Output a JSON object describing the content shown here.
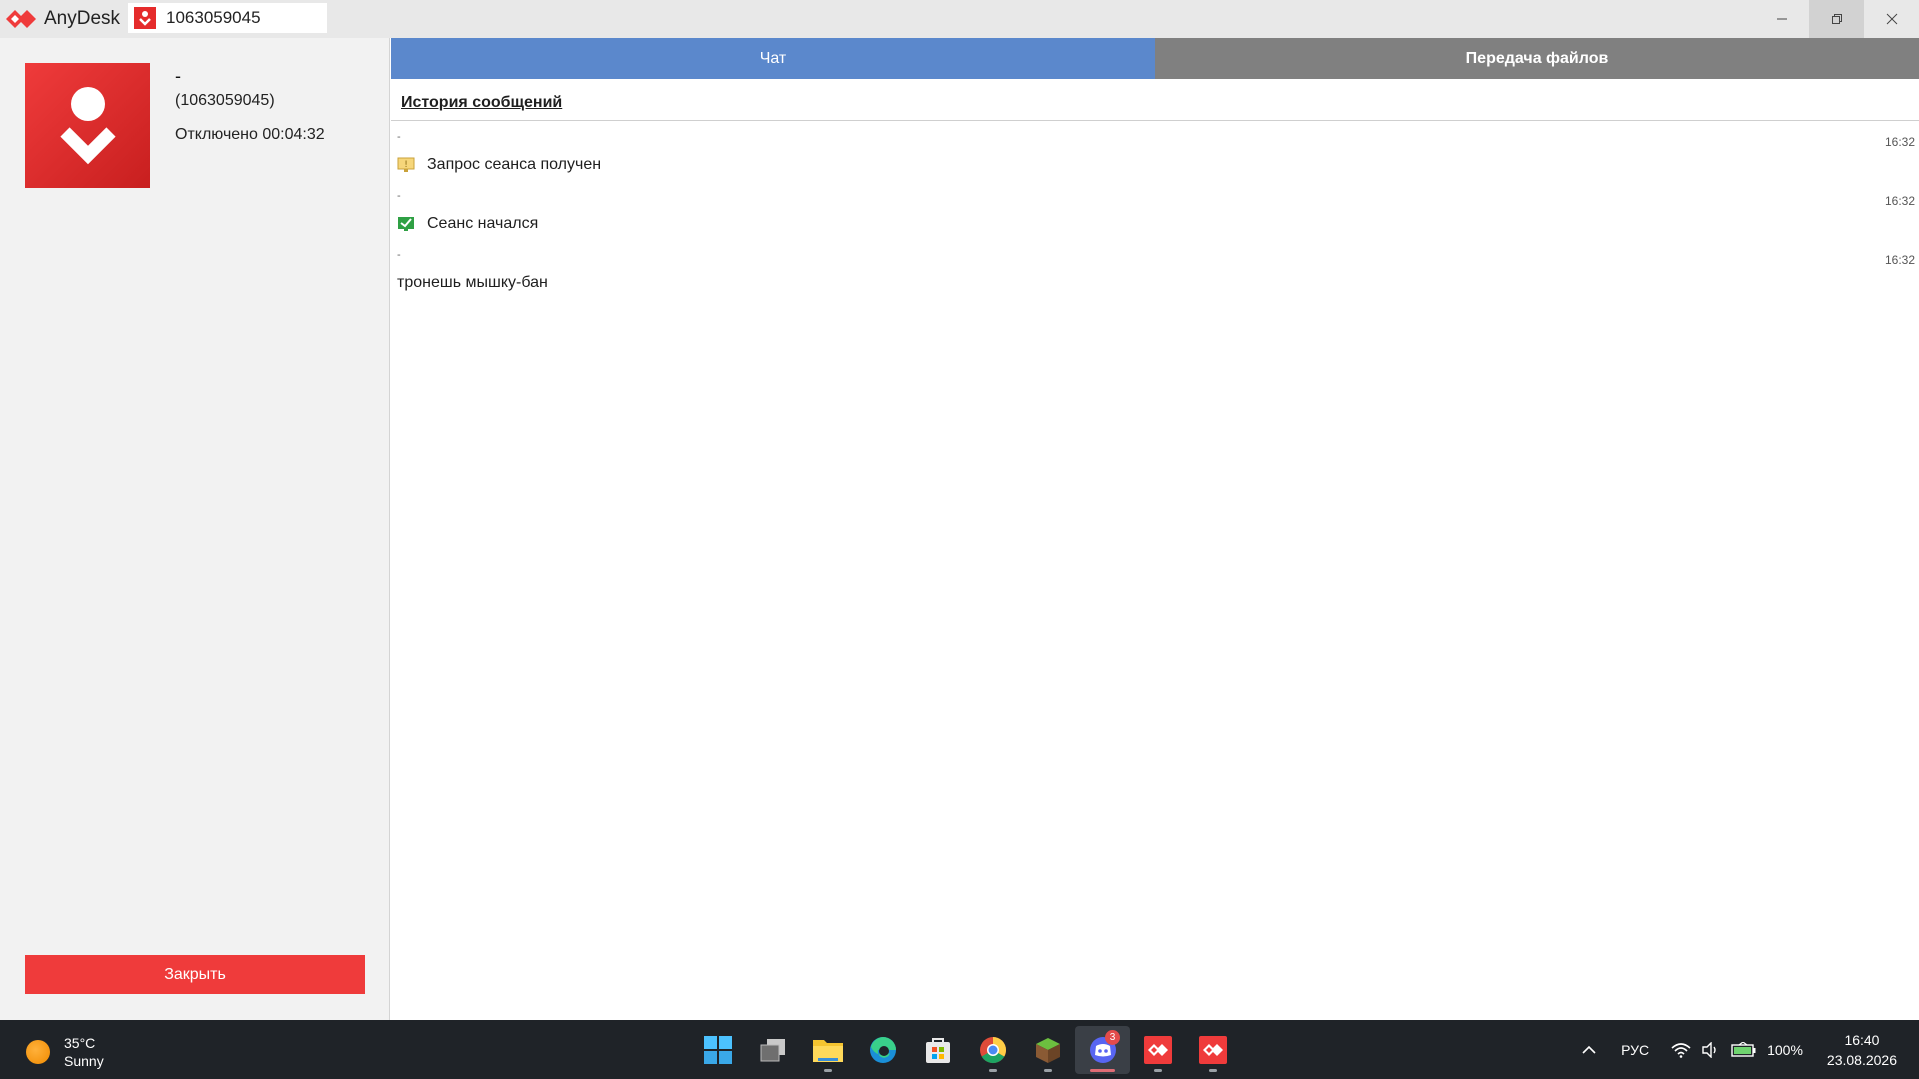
{
  "titlebar": {
    "app_name": "AnyDesk",
    "session_tab_label": "1063059045"
  },
  "left_panel": {
    "name": "-",
    "id": "(1063059045)",
    "status": "Отключено 00:04:32",
    "close_label": "Закрыть"
  },
  "tabs": {
    "chat": "Чат",
    "files": "Передача файлов"
  },
  "history": {
    "title": "История сообщений",
    "messages": [
      {
        "sender": "-",
        "time": "16:32",
        "text": "Запрос сеанса получен",
        "icon": "session-request-icon"
      },
      {
        "sender": "-",
        "time": "16:32",
        "text": "Сеанс начался",
        "icon": "session-started-check-icon"
      },
      {
        "sender": "-",
        "time": "16:32",
        "text": "тронешь мышку-бан",
        "icon": ""
      }
    ]
  },
  "taskbar": {
    "weather_temp": "35°C",
    "weather_desc": "Sunny",
    "apps": [
      "start-icon",
      "task-view-icon",
      "file-explorer-icon",
      "edge-icon",
      "store-icon",
      "chrome-icon",
      "minecraft-icon",
      "discord-icon",
      "anydesk-icon",
      "anydesk-icon"
    ],
    "discord_badge": "3",
    "lang": "РУС",
    "battery": "100%",
    "time": "16:40",
    "date": "23.08.2026"
  },
  "colors": {
    "anydesk_red": "#ef3b3b",
    "chat_tab": "#5b88cc",
    "files_tab": "#808080",
    "taskbar": "#1f2328"
  }
}
